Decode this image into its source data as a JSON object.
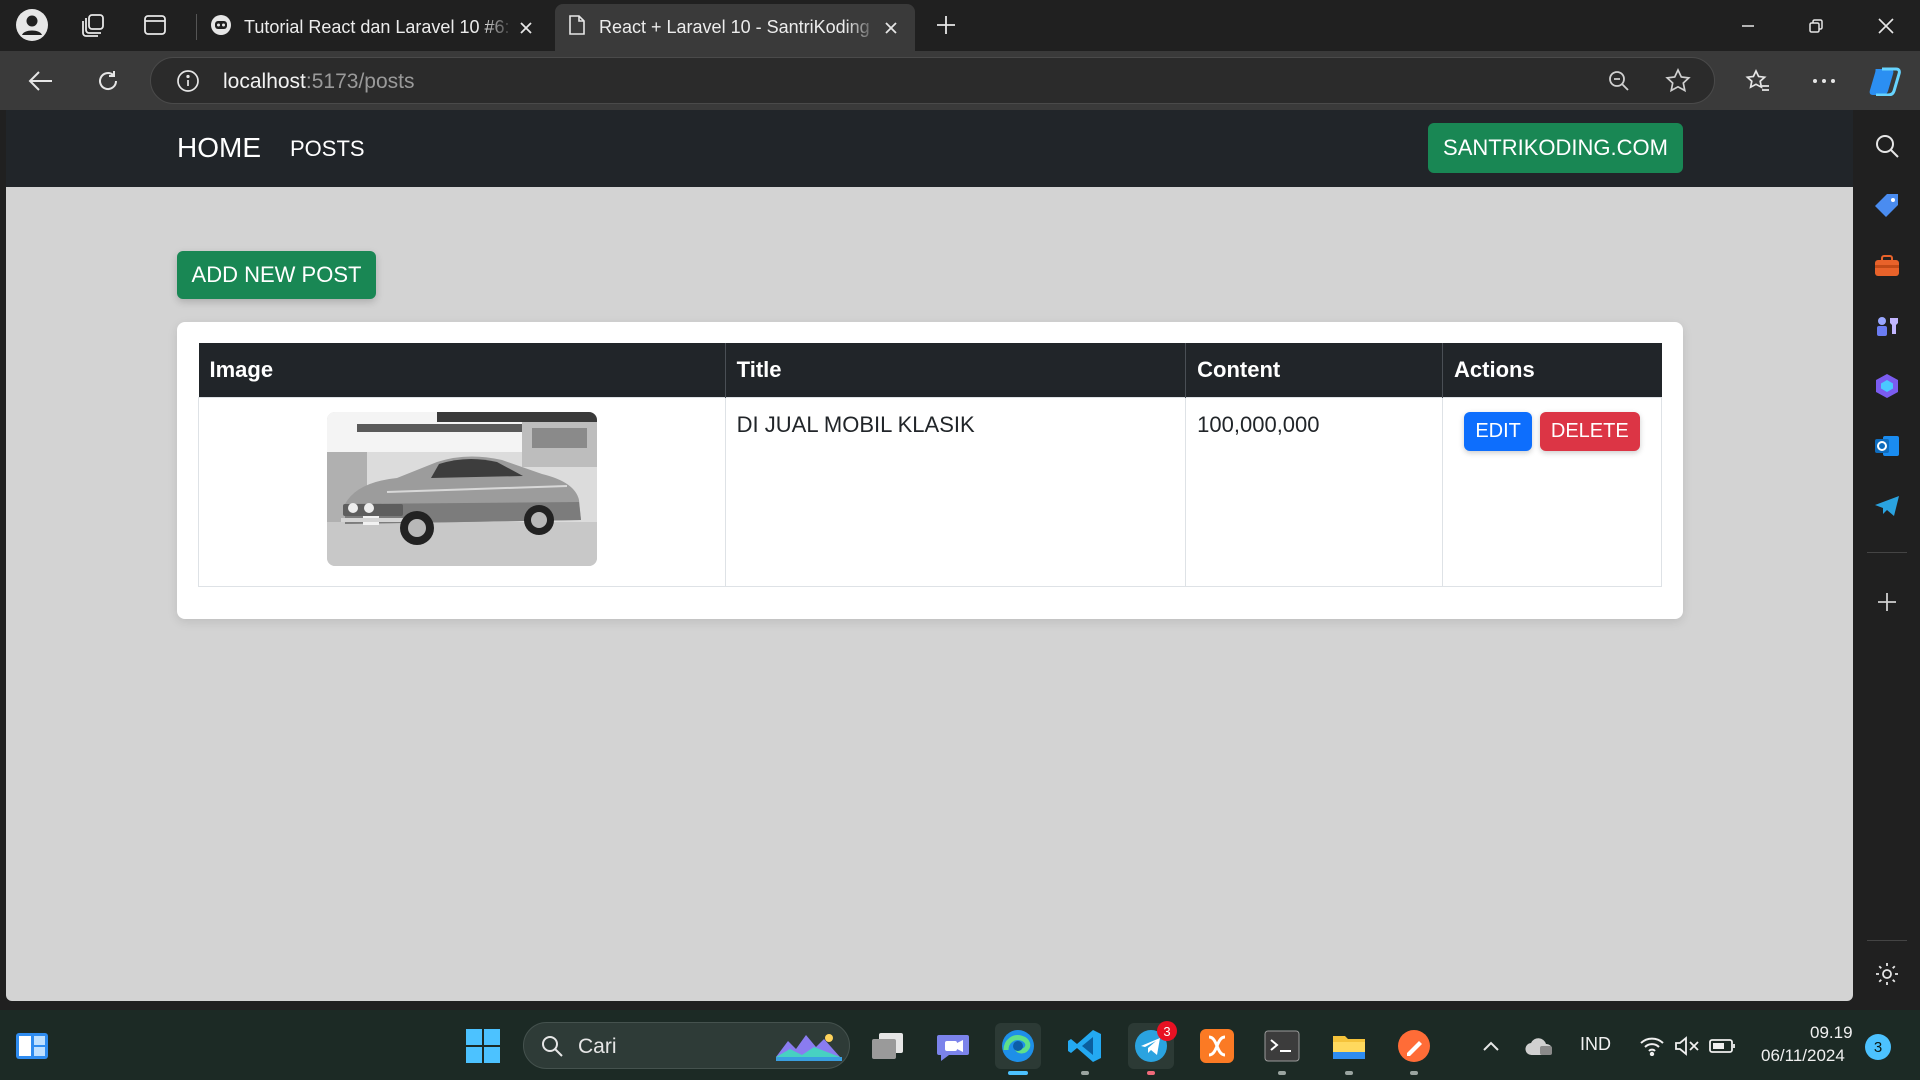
{
  "browser": {
    "tabs": [
      {
        "title": "Tutorial React dan Laravel 10 #6: ",
        "active": false
      },
      {
        "title": "React + Laravel 10 - SantriKoding",
        "active": true
      }
    ],
    "url_host": "localhost",
    "url_path": ":5173/posts"
  },
  "site": {
    "brand": "HOME",
    "nav_posts": "POSTS",
    "site_button": "SANTRIKODING.COM",
    "add_button": "ADD NEW POST",
    "table": {
      "headers": [
        "Image",
        "Title",
        "Content",
        "Actions"
      ],
      "rows": [
        {
          "title": "DI JUAL MOBIL KLASIK",
          "content": "100,000,000",
          "edit": "EDIT",
          "delete": "DELETE"
        }
      ]
    }
  },
  "taskbar": {
    "search_label": "Cari",
    "language": "IND",
    "time": "09.19",
    "date": "06/11/2024",
    "telegram_badge": "3",
    "notification_count": "3"
  },
  "colors": {
    "primary": "#0d6efd",
    "success": "#198754",
    "danger": "#dc3545",
    "dark": "#212529"
  }
}
